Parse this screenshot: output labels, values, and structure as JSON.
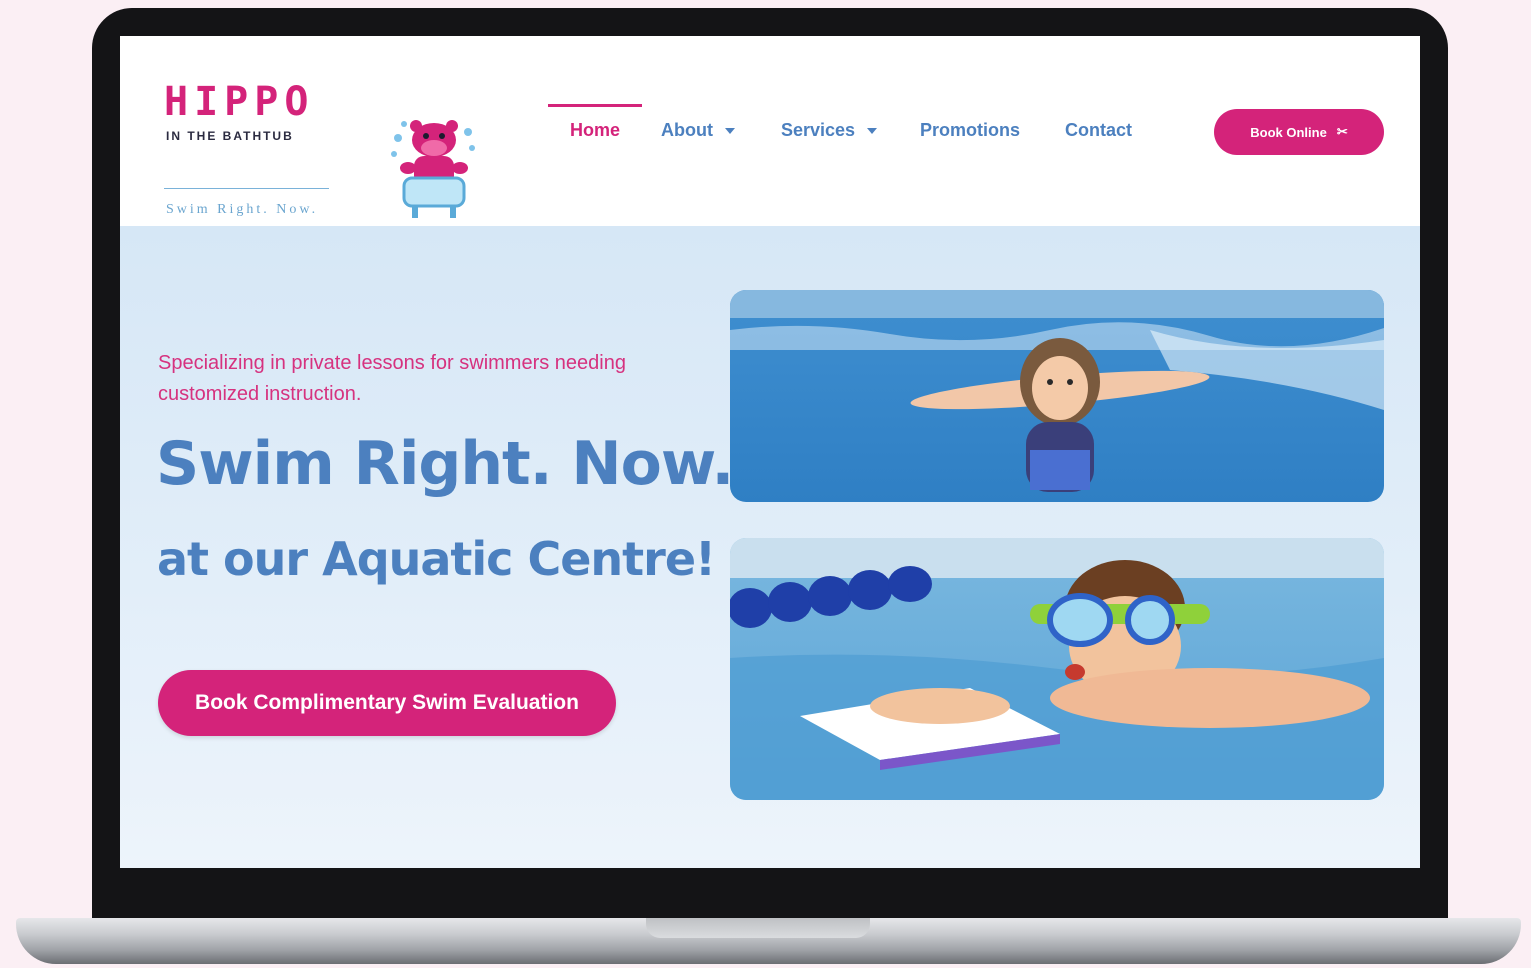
{
  "header": {
    "logo": {
      "wordmark": "HIPPO",
      "subtitle": "IN THE BATHTUB",
      "tagline": "Swim Right. Now."
    },
    "nav": [
      {
        "label": "Home",
        "active": true,
        "has_dropdown": false
      },
      {
        "label": "About",
        "active": false,
        "has_dropdown": true
      },
      {
        "label": "Services",
        "active": false,
        "has_dropdown": true
      },
      {
        "label": "Promotions",
        "active": false,
        "has_dropdown": false
      },
      {
        "label": "Contact",
        "active": false,
        "has_dropdown": false
      }
    ],
    "book_button": {
      "label": "Book Online",
      "icon": "scissors-icon"
    }
  },
  "hero": {
    "tagline": "Specializing in private lessons for swimmers needing customized instruction.",
    "headline": "Swim Right. Now.",
    "subheadline": "at our Aquatic Centre!",
    "cta_label": "Book Complimentary Swim Evaluation"
  },
  "photos": [
    {
      "subject": "girl-swimming-underwater"
    },
    {
      "subject": "boy-with-goggles-and-kickboard"
    }
  ],
  "colors": {
    "brand_pink": "#d4237a",
    "brand_blue": "#4c80bf",
    "hero_bg": "#dbeaf7",
    "device_frame": "#141416"
  }
}
